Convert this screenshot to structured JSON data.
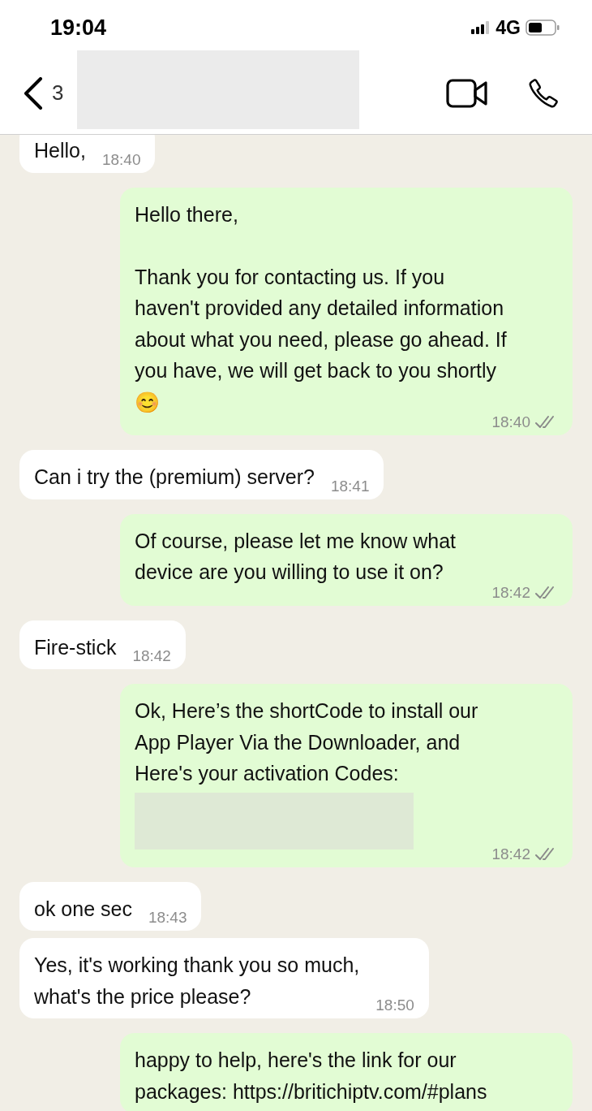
{
  "status_bar": {
    "time": "19:04",
    "network": "4G"
  },
  "header": {
    "back_count": "3",
    "contact_redacted": true
  },
  "messages": [
    {
      "kind": "incoming",
      "text": "Hello,",
      "time": "18:40"
    },
    {
      "kind": "outgoing",
      "text": "Hello there,\n\nThank you for contacting us. If you\nhaven't provided any detailed information\nabout what you need, please go ahead. If\nyou have, we will get back to you shortly\n😊",
      "time": "18:40",
      "read": false
    },
    {
      "kind": "incoming",
      "text": "Can i try the (premium) server?",
      "time": "18:41"
    },
    {
      "kind": "outgoing",
      "text": "Of course, please let me know what\ndevice are you willing to use it on?",
      "time": "18:42",
      "read": false
    },
    {
      "kind": "incoming",
      "text": "Fire-stick",
      "time": "18:42"
    },
    {
      "kind": "outgoing",
      "text": "Ok, Here’s the shortCode to install our\nApp Player Via the Downloader, and\nHere's your activation Codes:",
      "redacted": true,
      "time": "18:42",
      "read": false
    },
    {
      "kind": "incoming",
      "text": "ok one sec",
      "time": "18:43"
    },
    {
      "kind": "incoming",
      "text": "Yes, it's working thank you so much,\nwhat's the price please?",
      "time": "18:50"
    },
    {
      "kind": "outgoing",
      "text": "happy to help, here's the link for our\npackages: https://britichiptv.com/#plans"
    }
  ]
}
